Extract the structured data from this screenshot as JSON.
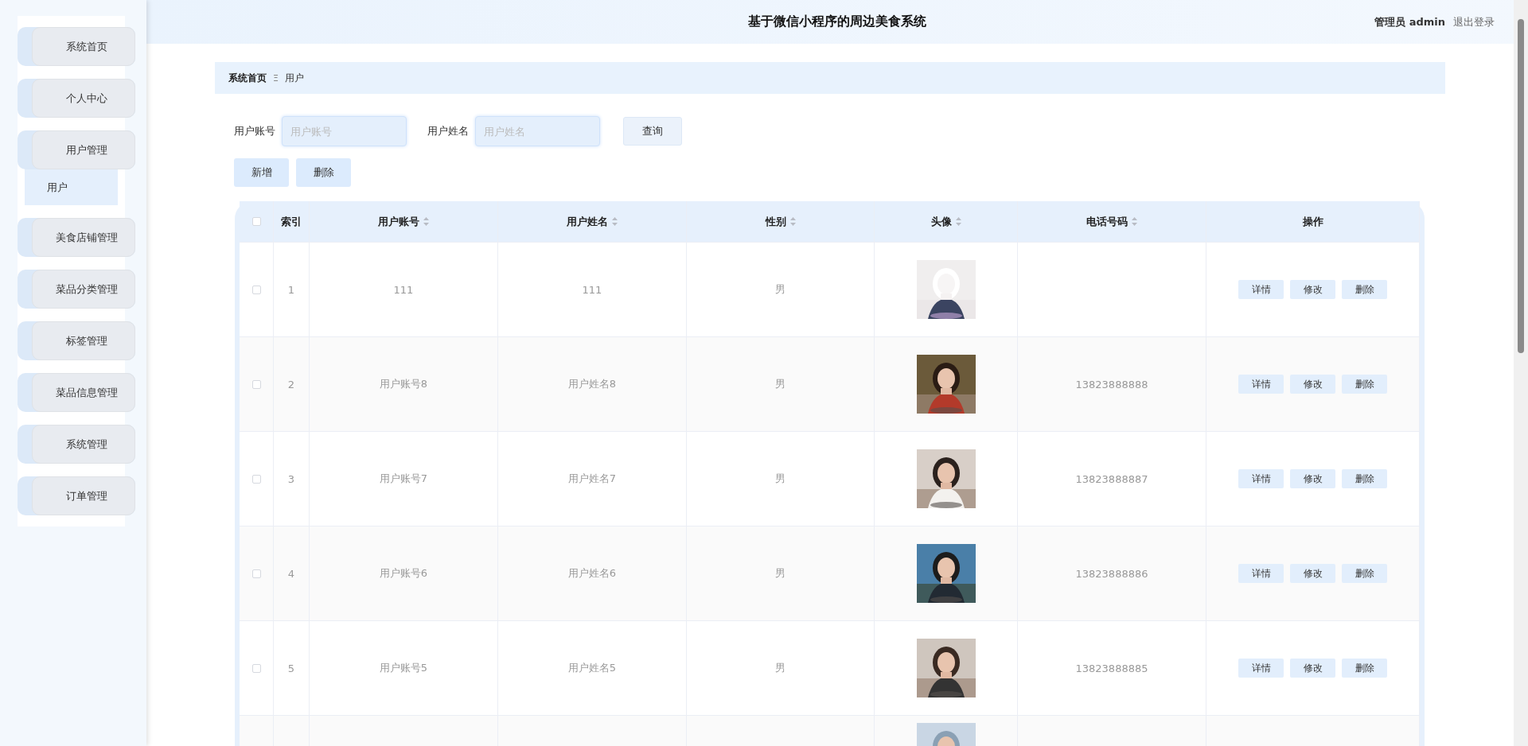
{
  "sidebar": {
    "items": [
      {
        "label": "系统首页",
        "expanded": false
      },
      {
        "label": "个人中心",
        "expanded": false
      },
      {
        "label": "用户管理",
        "expanded": true,
        "children": [
          {
            "label": "用户",
            "selected": true
          }
        ]
      },
      {
        "label": "美食店铺管理",
        "expanded": false
      },
      {
        "label": "菜品分类管理",
        "expanded": false
      },
      {
        "label": "标签管理",
        "expanded": false
      },
      {
        "label": "菜品信息管理",
        "expanded": false
      },
      {
        "label": "系统管理",
        "expanded": false
      },
      {
        "label": "订单管理",
        "expanded": false
      }
    ]
  },
  "header": {
    "title": "基于微信小程序的周边美食系统",
    "user": "管理员 admin",
    "logout": "退出登录"
  },
  "breadcrumb": {
    "home": "系统首页",
    "separator": "Ξ",
    "current": "用户"
  },
  "search": {
    "fields": [
      {
        "label": "用户账号",
        "placeholder": "用户账号"
      },
      {
        "label": "用户姓名",
        "placeholder": "用户姓名"
      }
    ],
    "button": "查询"
  },
  "actions": [
    "新增",
    "删除"
  ],
  "table": {
    "all_checked": false,
    "columns": [
      {
        "label": "索引",
        "sortable": false
      },
      {
        "label": "用户账号",
        "sortable": true
      },
      {
        "label": "用户姓名",
        "sortable": true
      },
      {
        "label": "性别",
        "sortable": true
      },
      {
        "label": "头像",
        "sortable": true
      },
      {
        "label": "电话号码",
        "sortable": true
      },
      {
        "label": "操作",
        "sortable": false
      }
    ],
    "rows": [
      {
        "checked": false,
        "index": "1",
        "account": "111",
        "name": "111",
        "gender": "男",
        "phone": "",
        "buttons": [
          "详情",
          "修改",
          "删除"
        ]
      },
      {
        "checked": false,
        "index": "2",
        "account": "用户账号8",
        "name": "用户姓名8",
        "gender": "男",
        "phone": "13823888888",
        "buttons": [
          "详情",
          "修改",
          "删除"
        ]
      },
      {
        "checked": false,
        "index": "3",
        "account": "用户账号7",
        "name": "用户姓名7",
        "gender": "男",
        "phone": "13823888887",
        "buttons": [
          "详情",
          "修改",
          "删除"
        ]
      },
      {
        "checked": false,
        "index": "4",
        "account": "用户账号6",
        "name": "用户姓名6",
        "gender": "男",
        "phone": "13823888886",
        "buttons": [
          "详情",
          "修改",
          "删除"
        ]
      },
      {
        "checked": false,
        "index": "5",
        "account": "用户账号5",
        "name": "用户姓名5",
        "gender": "男",
        "phone": "13823888885",
        "buttons": [
          "详情",
          "修改",
          "删除"
        ]
      },
      {
        "partial": true
      }
    ]
  }
}
